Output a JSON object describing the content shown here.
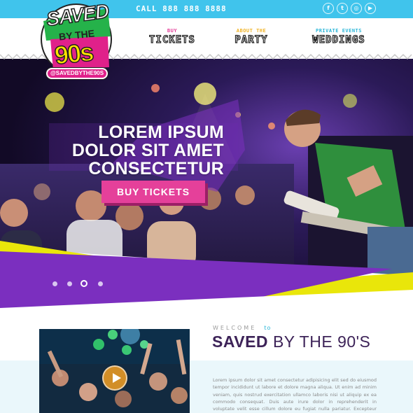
{
  "topbar": {
    "call": "CALL 888 888 8888",
    "social": [
      {
        "icon": "facebook-icon",
        "glyph": "f"
      },
      {
        "icon": "twitter-icon",
        "glyph": "t"
      },
      {
        "icon": "instagram-icon",
        "glyph": "◎"
      },
      {
        "icon": "youtube-icon",
        "glyph": "▶"
      }
    ]
  },
  "logo": {
    "line1": "SAVED",
    "line2": "BY THE",
    "line3": "90s",
    "handle": "@SAVEDBYTHE90S"
  },
  "nav": [
    {
      "sub": "BUY",
      "main": "TICKETS",
      "color": "#e5409a"
    },
    {
      "sub": "ABOUT THE",
      "main": "PARTY",
      "color": "#f0b428"
    },
    {
      "sub": "PRIVATE EVENTS",
      "main": "WEDDINGS",
      "color": "#2bb6d8"
    }
  ],
  "hero": {
    "title_lines": [
      "LOREM IPSUM",
      "DOLOR SIT AMET",
      "CONSECTETUR"
    ],
    "cta": "BUY TICKETS",
    "slides": 4,
    "active_slide": 2
  },
  "welcome": {
    "label": "WELCOME",
    "to": "to",
    "title_bold": "SAVED",
    "title_rest": "BY THE 90'S",
    "body": "Lorem ipsum dolor sit amet consectetur adipisicing elit sed do eiusmod tempor incididunt ut labore et dolore magna aliqua. Ut enim ad minim veniam, quis nostrud exercitation ullamco laboris nisi ut aliquip ex ea commodo consequat. Duis aute irure dolor in reprehenderit in voluptate velit esse cillum dolore eu fugiat nulla pariatur. Excepteur sint occaecat cupidatat non proident, sunt in"
  },
  "colors": {
    "accent_blue": "#40c4ec",
    "pink": "#e5409a",
    "purple": "#7b2fbf",
    "yellow": "#e8e800"
  }
}
